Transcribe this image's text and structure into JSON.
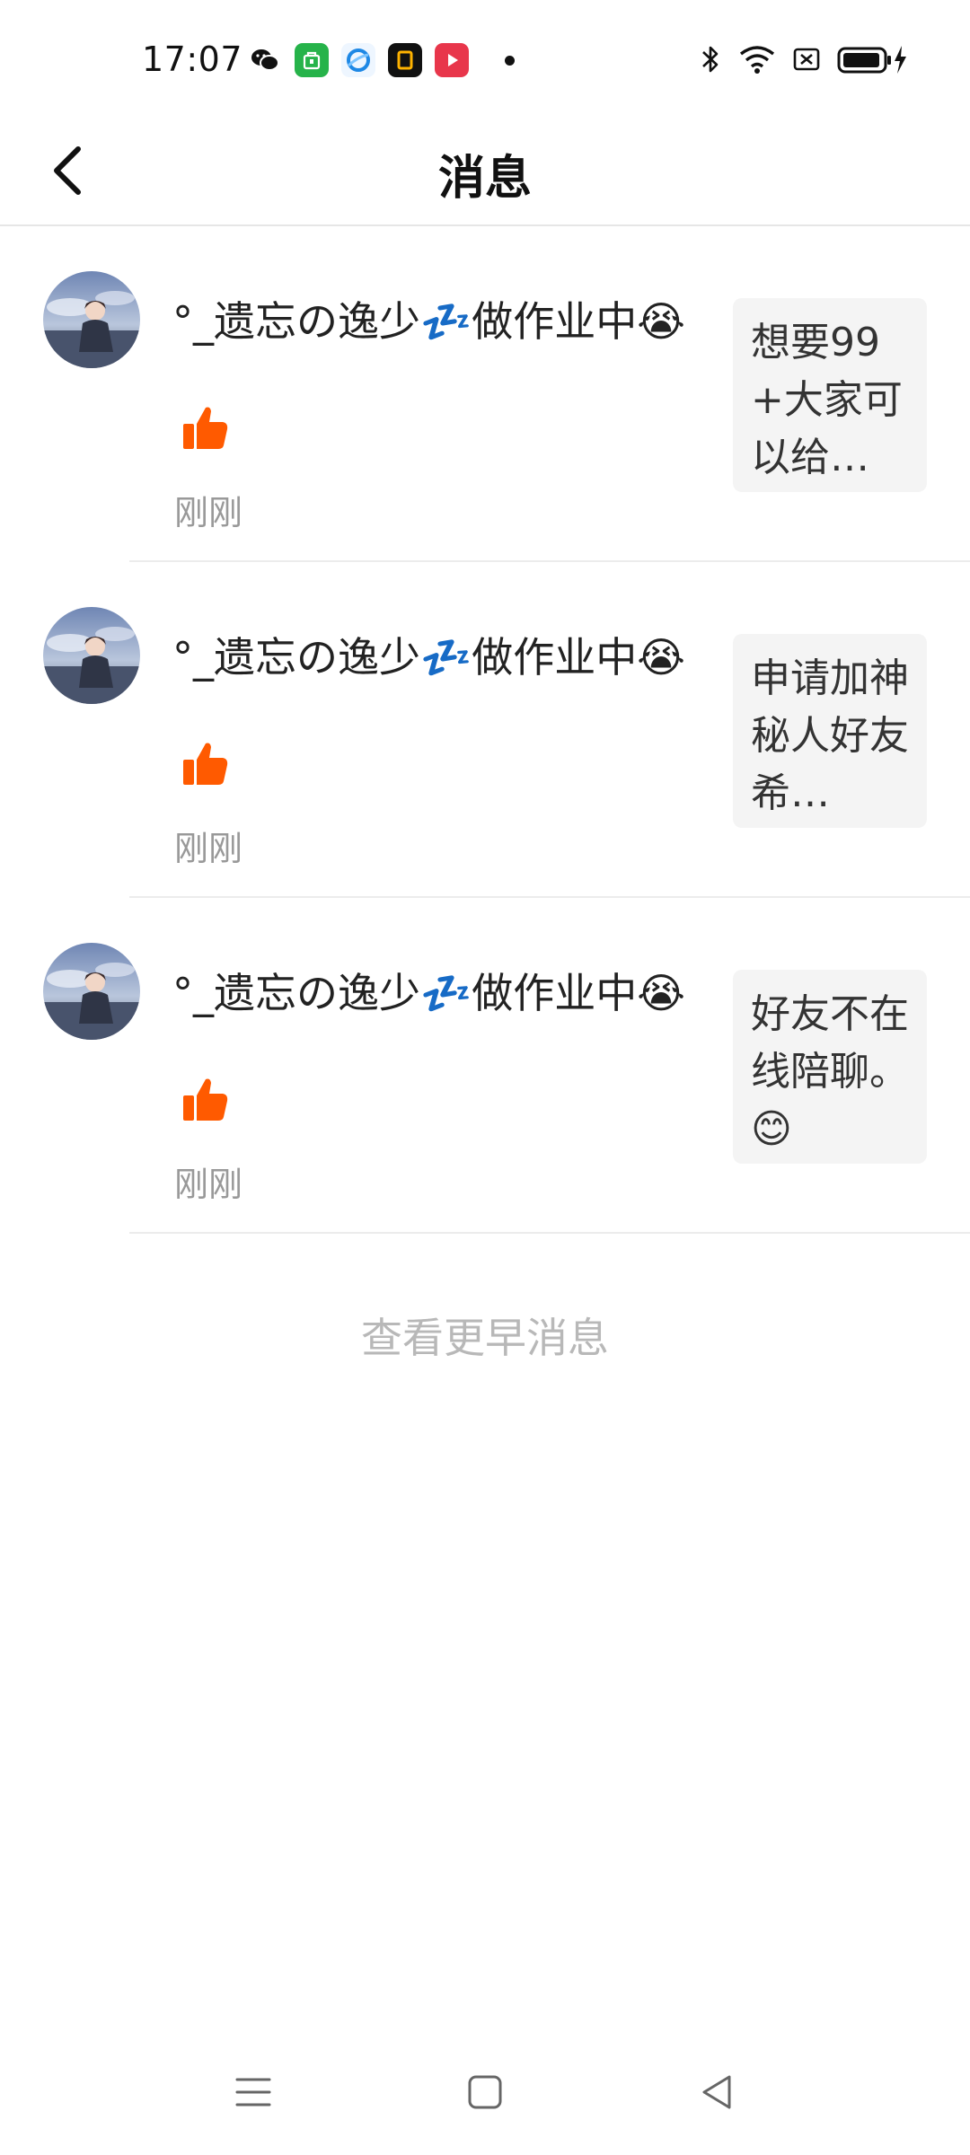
{
  "status_bar": {
    "time": "17:07",
    "apps": [
      "wechat-icon",
      "taobao-icon",
      "qq-browser-icon",
      "app-icon",
      "video-icon"
    ],
    "battery": "battery-icon"
  },
  "header": {
    "title": "消息"
  },
  "messages": [
    {
      "username": "°_遗忘の逸少💤做作业中😭",
      "time": "刚刚",
      "preview": "想要99+大家可以给…"
    },
    {
      "username": "°_遗忘の逸少💤做作业中😭",
      "time": "刚刚",
      "preview": "申请加神秘人好友希…"
    },
    {
      "username": "°_遗忘の逸少💤做作业中😭",
      "time": "刚刚",
      "preview": "好友不在线陪聊。😊"
    }
  ],
  "footer": {
    "view_earlier": "查看更早消息"
  },
  "colors": {
    "like": "#ff5a00",
    "muted_text": "#999999",
    "preview_bg": "#f4f4f4"
  }
}
